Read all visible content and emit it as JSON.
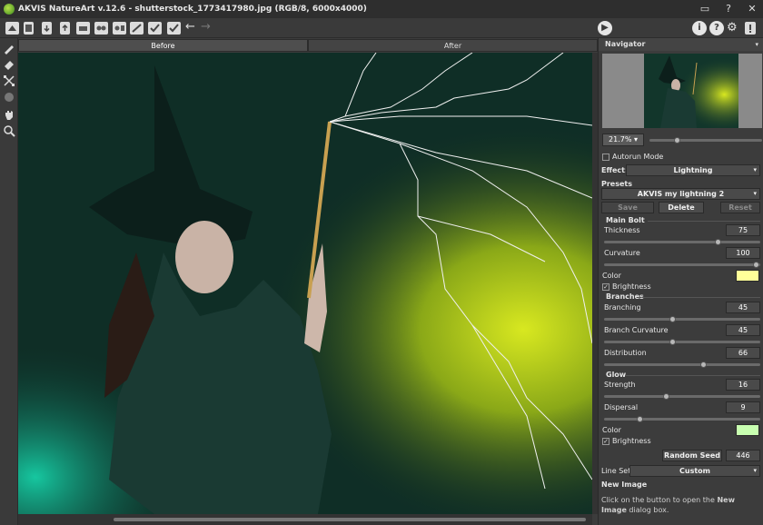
{
  "window": {
    "title": "AKVIS NatureArt v.12.6 - shutterstock_1773417980.jpg (RGB/8, 6000x4000)",
    "controls": [
      "▭",
      "?",
      "✕"
    ]
  },
  "tabs": {
    "before": "Before",
    "after": "After"
  },
  "navigator": {
    "title": "Navigator",
    "zoom": "21.7%",
    "zoom_arrow": "▾"
  },
  "settings": {
    "autorun_label": "Autorun Mode",
    "effect_label": "Effect:",
    "effect_value": "Lightning",
    "presets_label": "Presets",
    "preset_value": "AKVIS my lightning 2",
    "save_label": "Save",
    "delete_label": "Delete",
    "reset_label": "Reset",
    "main_bolt": {
      "title": "Main Bolt",
      "thickness_label": "Thickness",
      "thickness_value": "75",
      "curvature_label": "Curvature",
      "curvature_value": "100",
      "color_label": "Color",
      "color_hex": "#ffff99",
      "brightness_label": "Brightness"
    },
    "branches": {
      "title": "Branches",
      "branching_label": "Branching",
      "branching_value": "45",
      "branch_curvature_label": "Branch Curvature",
      "branch_curvature_value": "45",
      "distribution_label": "Distribution",
      "distribution_value": "66"
    },
    "glow": {
      "title": "Glow",
      "strength_label": "Strength",
      "strength_value": "16",
      "dispersal_label": "Dispersal",
      "dispersal_value": "9",
      "color_label": "Color",
      "color_hex": "#c8ffb0",
      "brightness_label": "Brightness"
    },
    "random_seed_label": "Random Seed",
    "random_seed_value": "446",
    "lineset_label": "Line Set",
    "lineset_value": "Custom"
  },
  "new_image": {
    "title": "New Image",
    "desc_1": "Click on the button to open the",
    "desc_bold": "New Image",
    "desc_2": "dialog box."
  },
  "colors": {
    "accent": "#3a8a1e",
    "panel_bg": "#3c3c3c"
  }
}
